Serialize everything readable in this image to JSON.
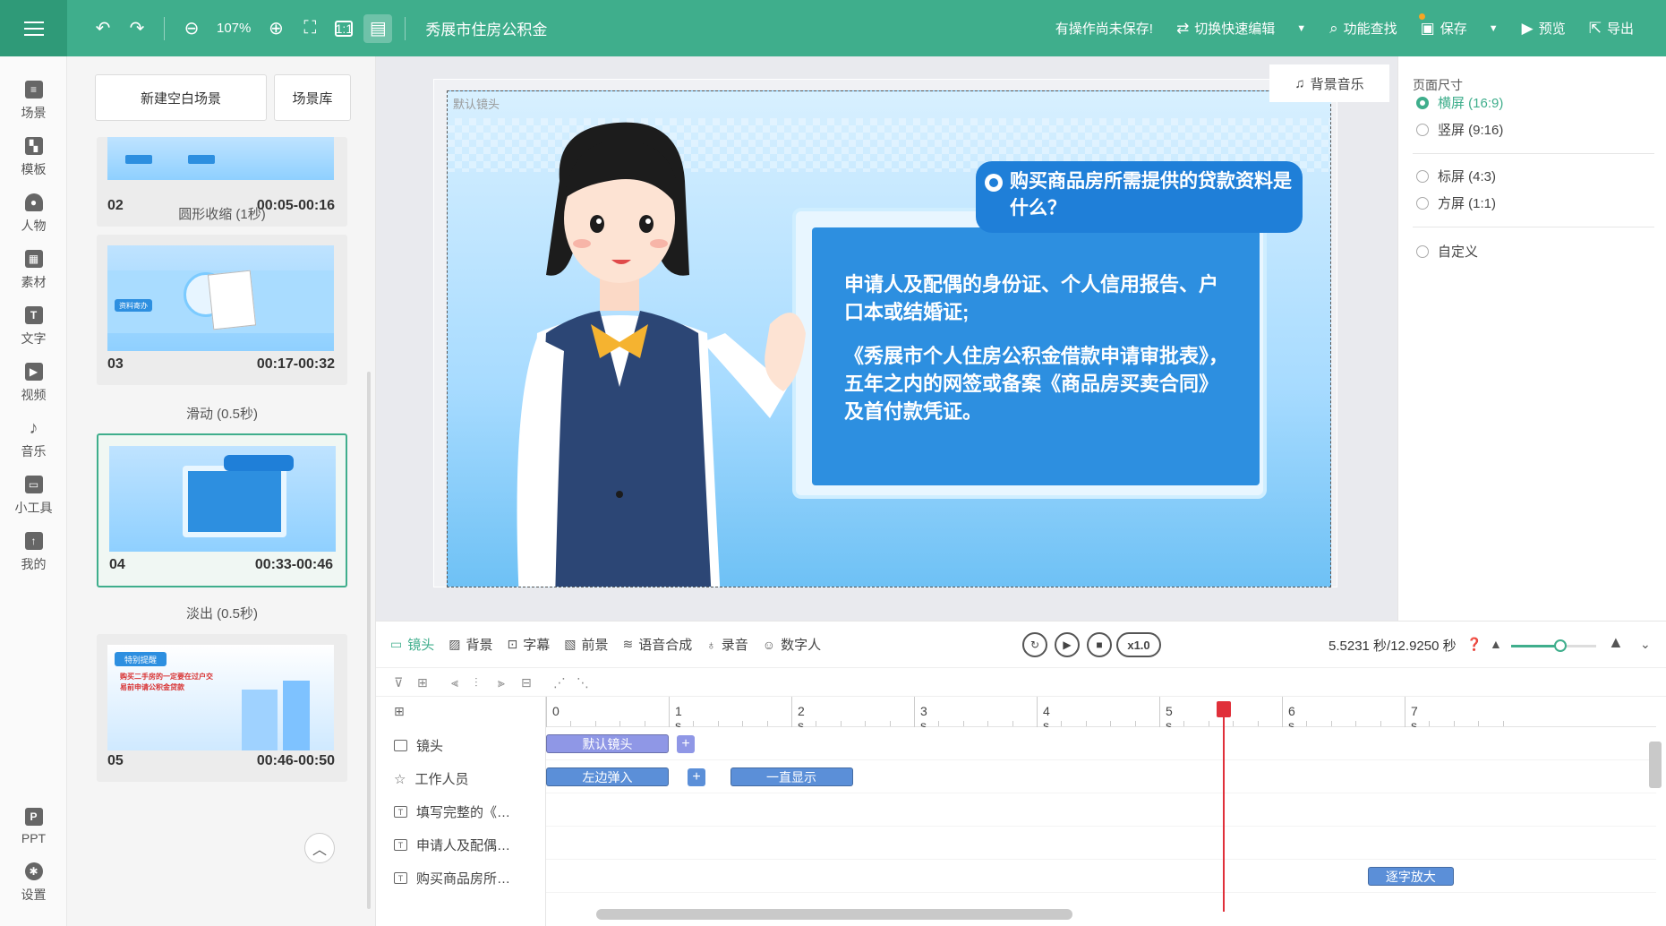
{
  "app": {
    "title": "秀展市住房公积金",
    "zoom": "107%",
    "unsaved_notice": "有操作尚未保存!",
    "switch_edit": "切换快速编辑",
    "find_feature": "功能查找",
    "save": "保存",
    "preview": "预览",
    "export": "导出"
  },
  "rail": {
    "items": [
      {
        "label": "场景",
        "icon": "scene-icon"
      },
      {
        "label": "模板",
        "icon": "template-icon"
      },
      {
        "label": "人物",
        "icon": "person-icon"
      },
      {
        "label": "素材",
        "icon": "asset-icon"
      },
      {
        "label": "文字",
        "icon": "text-icon"
      },
      {
        "label": "视频",
        "icon": "video-icon"
      },
      {
        "label": "音乐",
        "icon": "music-icon"
      },
      {
        "label": "小工具",
        "icon": "toolbox-icon"
      },
      {
        "label": "我的",
        "icon": "upload-icon"
      },
      {
        "label": "PPT",
        "icon": "ppt-icon"
      },
      {
        "label": "设置",
        "icon": "gear-icon"
      }
    ]
  },
  "scenes": {
    "new_blank": "新建空白场景",
    "library": "场景库",
    "cards": [
      {
        "num": "02",
        "time": "00:05-00:16",
        "transition": "圆形收缩 (1秒)"
      },
      {
        "num": "03",
        "time": "00:17-00:32",
        "transition": "滑动 (0.5秒)",
        "thumb_tag": "资料寄办"
      },
      {
        "num": "04",
        "time": "00:33-00:46",
        "transition": "淡出 (0.5秒)"
      },
      {
        "num": "05",
        "time": "00:46-00:50",
        "thumb_tag": "特别提醒",
        "thumb_text": "购买二手房的一定要在过户交易前申请公积金贷款"
      }
    ]
  },
  "canvas": {
    "lens_label": "默认镜头",
    "bgm": "背景音乐",
    "question": "购买商品房所需提供的贷款资料是什么？",
    "paragraph1": "申请人及配偶的身份证、个人信用报告、户口本或结婚证;",
    "paragraph2": "《秀展市个人住房公积金借款申请审批表》，五年之内的网签或备案《商品房买卖合同》及首付款凭证。"
  },
  "page_size": {
    "title": "页面尺寸",
    "options": [
      {
        "label": "横屏  (16:9)",
        "selected": true
      },
      {
        "label": "竖屏  (9:16)",
        "selected": false
      },
      {
        "label": "标屏  (4:3)",
        "selected": false
      },
      {
        "label": "方屏  (1:1)",
        "selected": false
      },
      {
        "label": "自定义",
        "selected": false
      }
    ]
  },
  "timeline": {
    "tabs": [
      "镜头",
      "背景",
      "字幕",
      "前景",
      "语音合成",
      "录音",
      "数字人"
    ],
    "speed": "x1.0",
    "time_readout": "5.5231 秒/12.9250 秒",
    "ruler": [
      "0",
      "1 s",
      "2 s",
      "3 s",
      "4 s",
      "5 s",
      "6 s",
      "7 s"
    ],
    "tracks": [
      {
        "label": "镜头",
        "clips": [
          {
            "text": "默认镜头",
            "start": 0,
            "end": 1.0
          }
        ]
      },
      {
        "label": "工作人员",
        "clips": [
          {
            "text": "左边弹入",
            "start": 0,
            "end": 1.0
          },
          {
            "text": "一直显示",
            "start": 1.5,
            "end": 2.5
          }
        ]
      },
      {
        "label": "填写完整的《…",
        "clips": []
      },
      {
        "label": "申请人及配偶…",
        "clips": []
      },
      {
        "label": "购买商品房所…",
        "clips": [
          {
            "text": "逐字放大",
            "start": 6.7,
            "end": 7.4
          }
        ]
      }
    ],
    "playhead_seconds": 5.5231,
    "total_seconds": 12.925
  },
  "colors": {
    "brand": "#3fae8c",
    "clip_camera": "#8f97e6",
    "clip_staff": "#5b8fd8",
    "playhead": "#e0303a"
  }
}
